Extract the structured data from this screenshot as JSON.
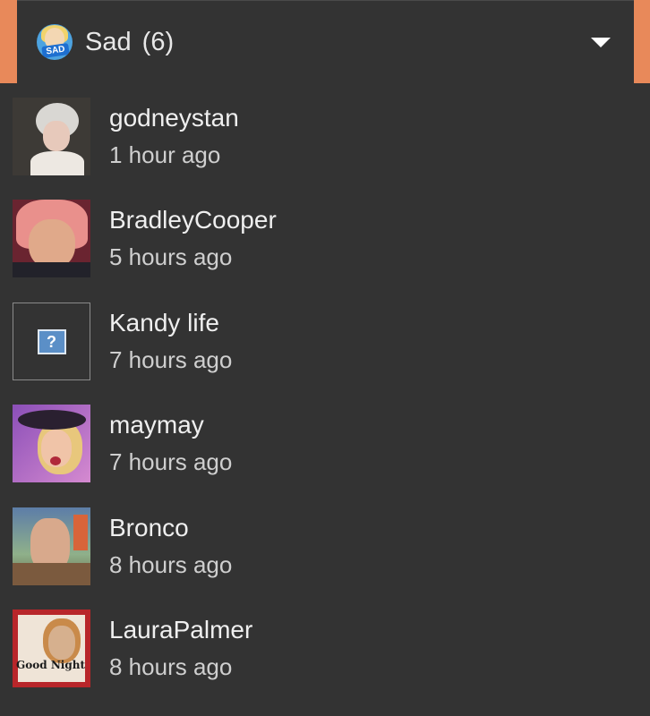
{
  "colors": {
    "accent_strip": "#e8895a",
    "panel_background": "#333333",
    "primary_text": "#efefef",
    "secondary_text": "#cfcfcf"
  },
  "dropdown": {
    "reaction_icon": "sad-reaction-icon",
    "reaction_icon_badge": "SAD",
    "title": "Sad",
    "count": "(6)",
    "caret_icon": "caret-down-icon"
  },
  "users": [
    {
      "name": "godneystan",
      "time": "1 hour ago",
      "avatar": "user-avatar"
    },
    {
      "name": "BradleyCooper",
      "time": "5 hours ago",
      "avatar": "user-avatar"
    },
    {
      "name": "Kandy life",
      "time": "7 hours ago",
      "avatar": "broken-image-icon",
      "avatar_glyph": "?"
    },
    {
      "name": "maymay",
      "time": "7 hours ago",
      "avatar": "user-avatar"
    },
    {
      "name": "Bronco",
      "time": "8 hours ago",
      "avatar": "user-avatar"
    },
    {
      "name": "LauraPalmer",
      "time": "8 hours ago",
      "avatar": "user-avatar",
      "avatar_text": "Good Night"
    }
  ]
}
